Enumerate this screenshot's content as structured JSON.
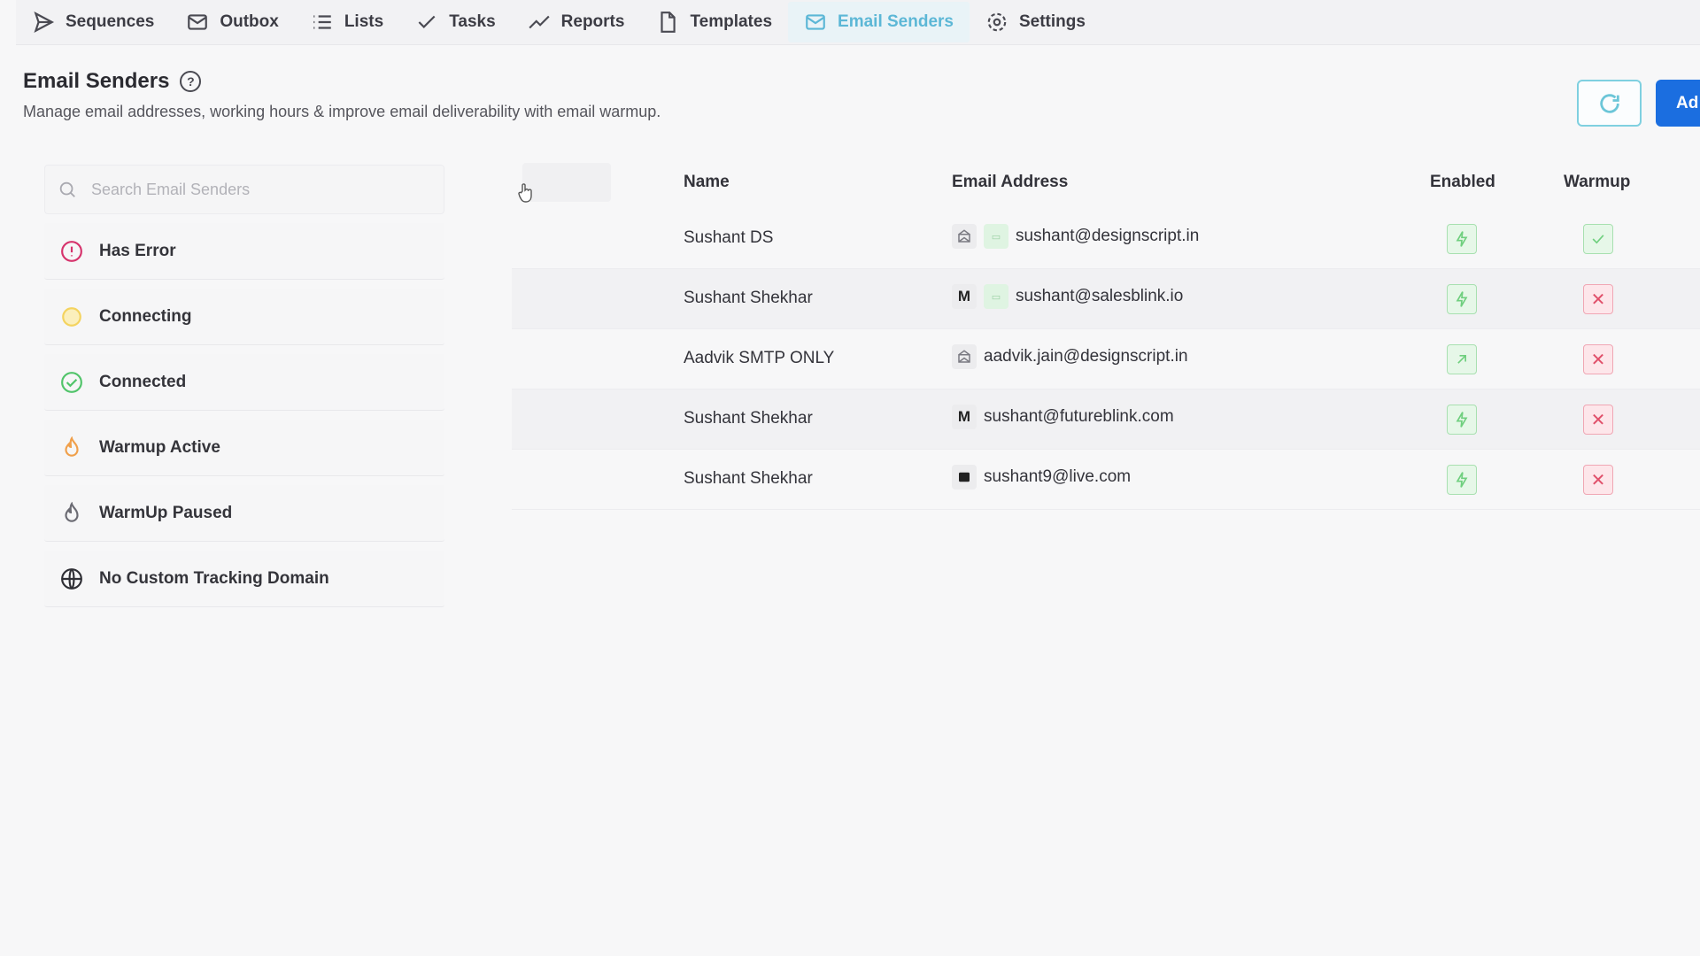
{
  "nav": [
    {
      "label": "Sequences",
      "icon": "send-icon",
      "active": false
    },
    {
      "label": "Outbox",
      "icon": "mail-icon",
      "active": false
    },
    {
      "label": "Lists",
      "icon": "list-icon",
      "active": false
    },
    {
      "label": "Tasks",
      "icon": "check-icon",
      "active": false
    },
    {
      "label": "Reports",
      "icon": "trend-icon",
      "active": false
    },
    {
      "label": "Templates",
      "icon": "file-icon",
      "active": false
    },
    {
      "label": "Email Senders",
      "icon": "mail-icon",
      "active": true
    },
    {
      "label": "Settings",
      "icon": "gear-icon",
      "active": false
    }
  ],
  "header": {
    "title": "Email Senders",
    "subtitle": "Manage email addresses, working hours & improve email deliverability with email warmup.",
    "add_label": "Ad"
  },
  "sidebar": {
    "search_placeholder": "Search Email Senders",
    "filters": [
      {
        "label": "Has Error",
        "icon": "alert-circle-icon",
        "color": "#d6336c"
      },
      {
        "label": "Connecting",
        "icon": "connecting-icon",
        "color": "#f4d35e"
      },
      {
        "label": "Connected",
        "icon": "check-circle-icon",
        "color": "#51c46a"
      },
      {
        "label": "Warmup Active",
        "icon": "flame-icon",
        "color": "#f0a04b"
      },
      {
        "label": "WarmUp Paused",
        "icon": "flame-icon",
        "color": "#6b6b73"
      },
      {
        "label": "No Custom Tracking Domain",
        "icon": "globe-icon",
        "color": "#2f2f35"
      }
    ]
  },
  "table": {
    "columns": {
      "name": "Name",
      "email": "Email Address",
      "enabled": "Enabled",
      "warmup": "Warmup"
    },
    "rows": [
      {
        "name": "Sushant DS",
        "email": "sushant@designscript.in",
        "provider": "smtp-icon",
        "has_tag": true,
        "enabled": true,
        "warmup": true
      },
      {
        "name": "Sushant Shekhar",
        "email": "sushant@salesblink.io",
        "provider": "gmail-icon",
        "has_tag": true,
        "enabled": true,
        "warmup": false
      },
      {
        "name": "Aadvik SMTP ONLY",
        "email": "aadvik.jain@designscript.in",
        "provider": "smtp-icon",
        "has_tag": false,
        "enabled": true,
        "warmup": false
      },
      {
        "name": "Sushant Shekhar",
        "email": "sushant@futureblink.com",
        "provider": "gmail-icon",
        "has_tag": false,
        "enabled": true,
        "warmup": false
      },
      {
        "name": "Sushant Shekhar",
        "email": "sushant9@live.com",
        "provider": "outlook-icon",
        "has_tag": false,
        "enabled": true,
        "warmup": false
      }
    ]
  }
}
